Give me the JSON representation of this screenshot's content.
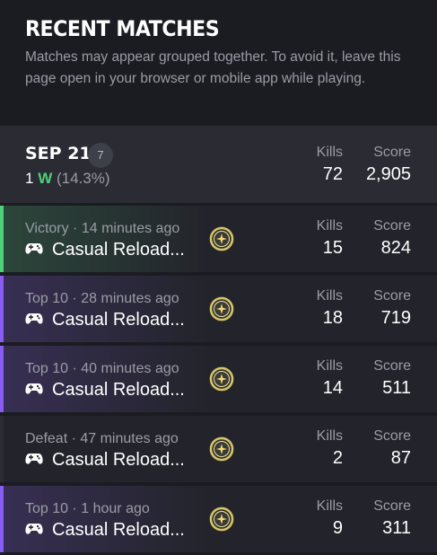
{
  "header": {
    "title": "RECENT MATCHES",
    "subtitle": "Matches may appear grouped together. To avoid it, leave this page open in your browser or mobile app while playing."
  },
  "day": {
    "date": "SEP 21",
    "count": "7",
    "wins": "1",
    "wins_suffix": "W",
    "pct": "(14.3%)",
    "kills_label": "Kills",
    "kills": "72",
    "score_label": "Score",
    "score": "2,905"
  },
  "colors": {
    "victory": "#4fd07a",
    "top10": "#8a5cf6",
    "defeat": "#2a2b33"
  },
  "matches": [
    {
      "result": "Victory",
      "time": "14 minutes ago",
      "meta": "Victory · 14 minutes ago",
      "mode": "Casual Reload...",
      "kills_label": "Kills",
      "kills": "15",
      "score_label": "Score",
      "score": "824",
      "accent": "victory",
      "icon": "medal-icon"
    },
    {
      "result": "Top 10",
      "time": "28 minutes ago",
      "meta": "Top 10 · 28 minutes ago",
      "mode": "Casual Reload...",
      "kills_label": "Kills",
      "kills": "18",
      "score_label": "Score",
      "score": "719",
      "accent": "top10",
      "icon": "medal-icon"
    },
    {
      "result": "Top 10",
      "time": "40 minutes ago",
      "meta": "Top 10 · 40 minutes ago",
      "mode": "Casual Reload...",
      "kills_label": "Kills",
      "kills": "14",
      "score_label": "Score",
      "score": "511",
      "accent": "top10",
      "icon": "medal-icon"
    },
    {
      "result": "Defeat",
      "time": "47 minutes ago",
      "meta": "Defeat · 47 minutes ago",
      "mode": "Casual Reload...",
      "kills_label": "Kills",
      "kills": "2",
      "score_label": "Score",
      "score": "87",
      "accent": "defeat",
      "icon": "medal-icon"
    },
    {
      "result": "Top 10",
      "time": "1 hour ago",
      "meta": "Top 10 · 1 hour ago",
      "mode": "Casual Reload...",
      "kills_label": "Kills",
      "kills": "9",
      "score_label": "Score",
      "score": "311",
      "accent": "top10",
      "icon": "medal-icon"
    }
  ]
}
